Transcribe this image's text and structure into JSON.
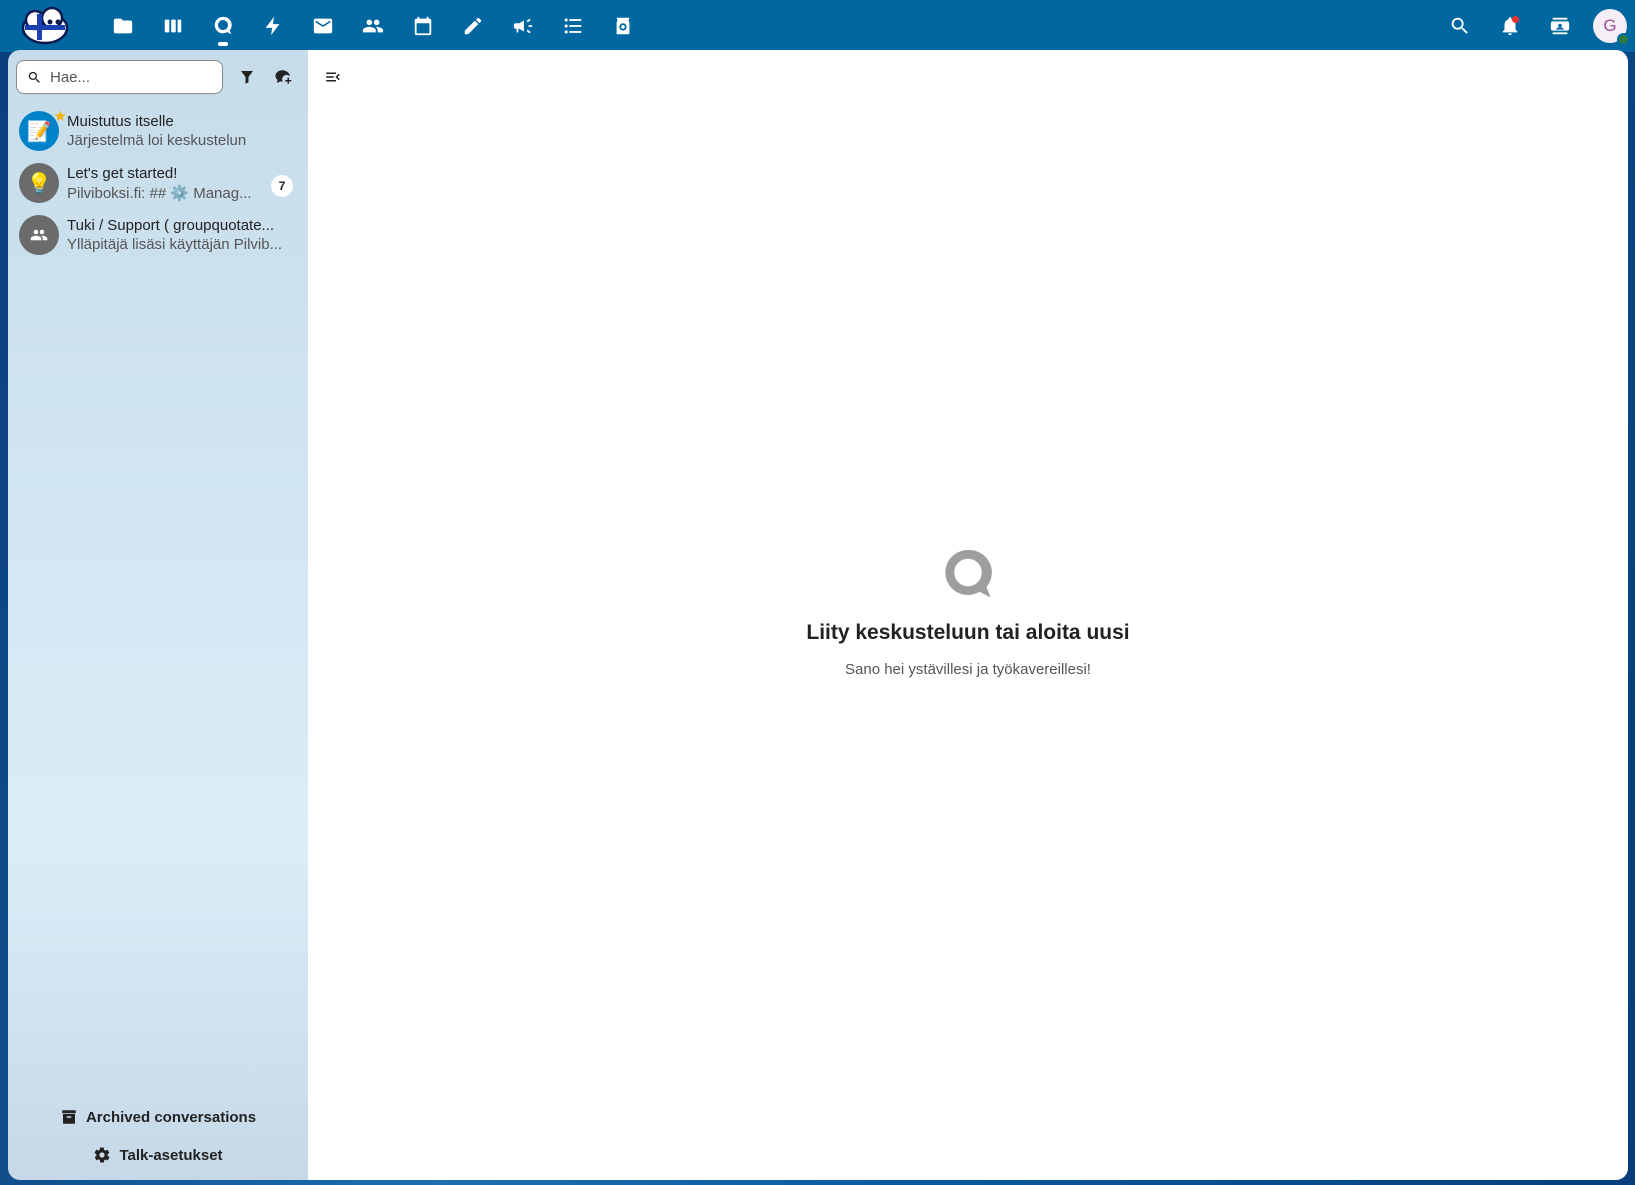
{
  "header": {
    "apps": [
      {
        "name": "files",
        "icon": "folder-icon"
      },
      {
        "name": "deck",
        "icon": "deck-icon"
      },
      {
        "name": "talk",
        "icon": "talk-icon",
        "active": true
      },
      {
        "name": "activity",
        "icon": "lightning-icon"
      },
      {
        "name": "mail",
        "icon": "mail-icon"
      },
      {
        "name": "contacts",
        "icon": "contacts-icon"
      },
      {
        "name": "calendar",
        "icon": "calendar-icon"
      },
      {
        "name": "notes",
        "icon": "pencil-icon"
      },
      {
        "name": "announcements",
        "icon": "megaphone-icon"
      },
      {
        "name": "tasks",
        "icon": "checklist-icon"
      },
      {
        "name": "cospend",
        "icon": "cospend-icon"
      }
    ],
    "avatar_initial": "G"
  },
  "sidebar": {
    "search_placeholder": "Hae...",
    "conversations": [
      {
        "title": "Muistutus itselle",
        "subtitle": "Järjestelmä loi keskustelun",
        "avatar_icon": "note-icon",
        "avatar_color": "#0082c9",
        "favorite": true
      },
      {
        "title": "Let's get started!",
        "subtitle": "Pilviboksi.fi: ## ⚙️ Manag...",
        "avatar_icon": "lightbulb-icon",
        "avatar_color": "#6b6b6b",
        "unread": "7"
      },
      {
        "title": "Tuki / Support ( groupquotate...",
        "subtitle": "Ylläpitäjä lisäsi käyttäjän Pilvib...",
        "avatar_icon": "group-icon",
        "avatar_color": "#6b6b6b"
      }
    ],
    "footer": {
      "archived_label": "Archived conversations",
      "settings_label": "Talk-asetukset"
    }
  },
  "main": {
    "empty_title": "Liity keskusteluun tai aloita uusi",
    "empty_subtitle": "Sano hei ystävillesi ja työkavereillesi!"
  },
  "colors": {
    "header_bg": "#0067a1",
    "accent": "#0082c9"
  }
}
